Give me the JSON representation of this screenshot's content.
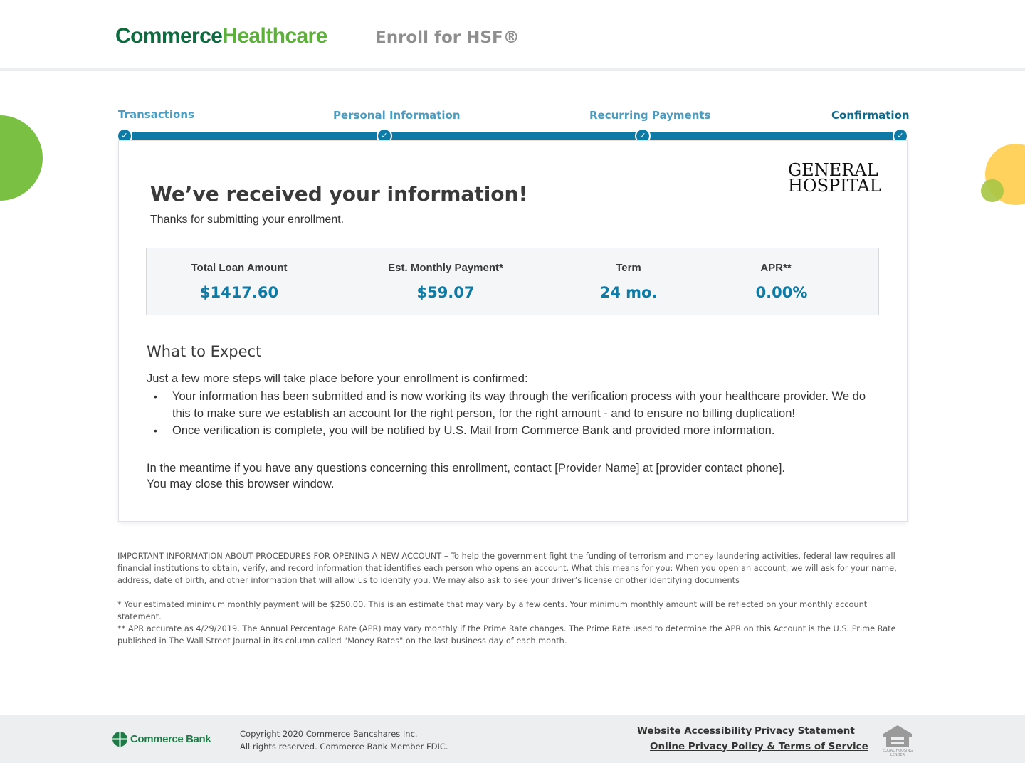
{
  "header": {
    "logo_part1": "Commerce",
    "logo_part2": "Healthcare",
    "title": "Enroll for HSF®"
  },
  "steps": [
    {
      "label": "Transactions"
    },
    {
      "label": "Personal Information"
    },
    {
      "label": "Recurring Payments"
    },
    {
      "label": "Confirmation"
    }
  ],
  "card": {
    "provider_logo_line1": "GENERAL",
    "provider_logo_line2": "HOSPITAL",
    "title": "We’ve received your information!",
    "subtitle": "Thanks for submitting your enrollment."
  },
  "summary": [
    {
      "label": "Total Loan Amount",
      "value": "$1417.60"
    },
    {
      "label": "Est. Monthly Payment*",
      "value": "$59.07"
    },
    {
      "label": "Term",
      "value": "24 mo."
    },
    {
      "label": "APR**",
      "value": "0.00%"
    }
  ],
  "expect": {
    "title": "What to Expect",
    "intro": "Just a few more steps will take place before your enrollment is confirmed:",
    "bullets": [
      "Your information has been submitted and is now working its way through the verification process with your healthcare provider. We do this to make sure we establish an account for the right person, for the right amount - and to ensure no billing duplication!",
      "Once verification is complete, you will be notified by U.S. Mail from Commerce Bank and provided more information."
    ],
    "meantime": "In the meantime if you have any questions concerning this enrollment, contact [Provider Name] at [provider contact phone].",
    "close": "You may close this browser window."
  },
  "disclosures": {
    "important": "IMPORTANT INFORMATION ABOUT PROCEDURES FOR OPENING A NEW ACCOUNT – To help the government fight the funding of terrorism and money laundering activities, federal law requires all financial institutions to obtain, verify, and record information that identifies each person who opens an account. What this means for you: When you open an account, we will ask for your name, address, date of birth, and other information that will allow us to identify you. We may also ask to see your driver’s license or other identifying documents",
    "payment": "*  Your estimated minimum monthly payment will be $250.00.  This is an estimate that may vary by a few cents.  Your minimum monthly amount will be reflected on your monthly account statement.",
    "apr": "** APR accurate as 4/29/2019. The Annual Percentage Rate (APR) may vary monthly if the Prime Rate changes. The Prime Rate used to determine the APR on this Account is the U.S. Prime Rate published in The Wall Street Journal in its column called \"Money Rates\" on the last business day of each month."
  },
  "footer": {
    "bank_name": "Commerce Bank",
    "copyright_line1": "Copyright 2020 Commerce Bancshares Inc.",
    "copyright_line2": "All rights reserved. Commerce Bank Member FDIC.",
    "links": {
      "accessibility": "Website Accessibility",
      "privacy": "Privacy Statement",
      "online_privacy": "Online Privacy Policy & Terms of Service"
    },
    "ehl_line1": "EQUAL HOUSING",
    "ehl_line2": "LENDER"
  },
  "colors": {
    "accent": "#0e7aa6",
    "brand_green": "#0f6b3f",
    "brand_light_green": "#5db03a"
  }
}
